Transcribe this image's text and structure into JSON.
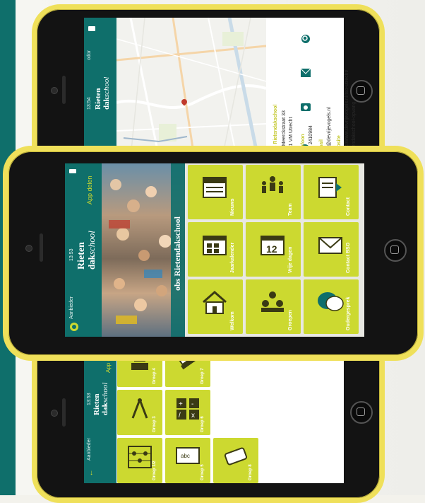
{
  "colors": {
    "teal": "#0f6f6b",
    "lime": "#ccd930",
    "frame": "#efe05a"
  },
  "phones": {
    "top": {
      "status": {
        "time": "13:54",
        "carrier": "odor"
      },
      "brand": {
        "line1": "Rieten",
        "line2a": "dak",
        "line2b": "school"
      },
      "contact": {
        "name": "obs Rietendakschool",
        "address1": "Ter Meerckstraat 33",
        "address2": "3541 VM Utrecht",
        "phone_head": "Telefoon",
        "phone": "030 2410984",
        "mail_head": "E-mail",
        "mail": "info@devrijevogels.nl",
        "web_head": "Website",
        "web": "http://www.devrijevogels.nl/tso-utrecht/",
        "web2": "rietendakschool-opvang"
      }
    },
    "middle": {
      "status": {
        "carrier": "Aanbieder",
        "time": "13:53"
      },
      "brand": {
        "line1": "Rieten",
        "line2a": "dak",
        "line2b": "school"
      },
      "share_label": "App delen",
      "banner_title": "obs Rietendakschool",
      "tiles": [
        {
          "label": "Welkom",
          "icon": "school-house-icon"
        },
        {
          "label": "Groepen",
          "icon": "group-icon"
        },
        {
          "label": "Oudergesprek",
          "icon": "speech-bubbles-icon"
        },
        {
          "label": "Jaarkalender",
          "icon": "calendar-icon"
        },
        {
          "label": "Vrije dagen",
          "icon": "calendar-12-icon"
        },
        {
          "label": "Contact BSO",
          "icon": "envelope-icon"
        },
        {
          "label": "Nieuws",
          "icon": "news-icon"
        },
        {
          "label": "Team",
          "icon": "team-icon"
        },
        {
          "label": "Contact",
          "icon": "contact-form-icon"
        }
      ]
    },
    "bottom": {
      "status": {
        "carrier": "Aanbieder",
        "time": "13:53"
      },
      "brand": {
        "line1": "Rieten",
        "line2a": "dak",
        "line2b": "school"
      },
      "share_label": "App de",
      "tiles": [
        {
          "label": "Groep 1/2",
          "icon": "abacus-icon"
        },
        {
          "label": "Groep 5",
          "icon": "chalkboard-icon"
        },
        {
          "label": "Groep 8",
          "icon": "diploma-icon"
        },
        {
          "label": "Groep 3",
          "icon": "compass-icon"
        },
        {
          "label": "Groep 6",
          "icon": "calculator-icon"
        },
        {
          "label": "Groep 4",
          "icon": "robot-icon"
        },
        {
          "label": "Groep 7",
          "icon": "ruler-pencil-icon"
        }
      ]
    }
  }
}
